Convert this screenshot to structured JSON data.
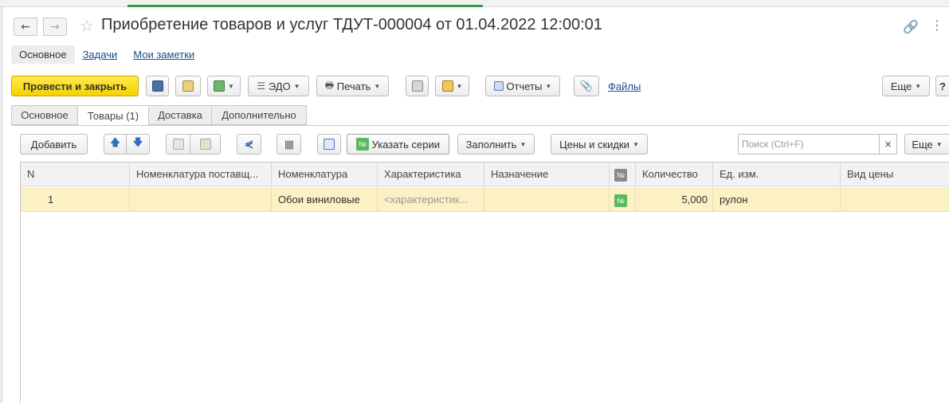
{
  "window": {
    "title": "Приобретение товаров и услуг ТДУТ-000004 от 01.04.2022 12:00:01"
  },
  "section_tabs": {
    "main": "Основное",
    "tasks": "Задачи",
    "notes": "Мои заметки"
  },
  "toolbar": {
    "post_close": "Провести и закрыть",
    "edo": "ЭДО",
    "print": "Печать",
    "reports": "Отчеты",
    "files": "Файлы",
    "more": "Еще"
  },
  "tabs": [
    {
      "label": "Основное"
    },
    {
      "label": "Товары (1)"
    },
    {
      "label": "Доставка"
    },
    {
      "label": "Дополнительно"
    }
  ],
  "grid_toolbar": {
    "add": "Добавить",
    "series": "Указать серии",
    "fill": "Заполнить",
    "prices": "Цены и скидки",
    "search_placeholder": "Поиск (Ctrl+F)",
    "clear": "×",
    "more": "Еще"
  },
  "table": {
    "columns": [
      "N",
      "Номенклатура поставщ...",
      "Номенклатура",
      "Характеристика",
      "Назначение",
      "№",
      "Количество",
      "Ед. изм.",
      "Вид цены"
    ],
    "rows": [
      {
        "n": "1",
        "supplier_item": "",
        "item": "Обои виниловые",
        "characteristic": "<характеристик...",
        "purpose": "",
        "series_flag": "№",
        "quantity": "5,000",
        "unit": "рулон",
        "price_type": ""
      }
    ]
  },
  "colors": {
    "primary_button": "#f5d200",
    "selected_row": "#fbf1c4",
    "link": "#1a4c8c",
    "active_tab_indicator": "#3a9a4a"
  }
}
